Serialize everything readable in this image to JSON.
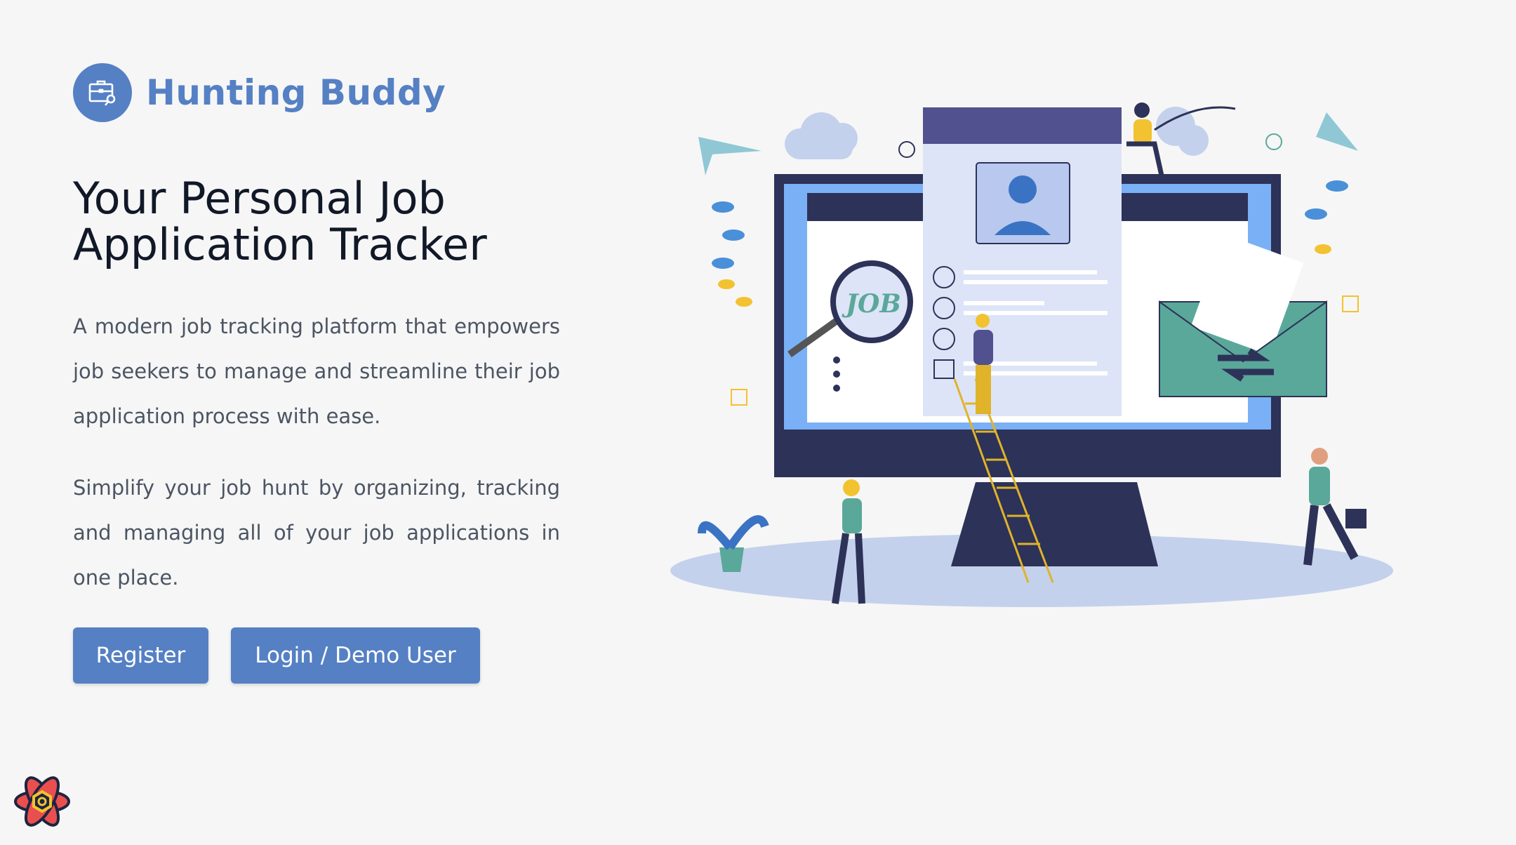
{
  "brand": {
    "name": "Hunting Buddy",
    "icon": "briefcase-search-icon",
    "color": "#5580c4"
  },
  "hero": {
    "title": "Your Personal Job Application Tracker",
    "paragraph_1": "A modern job tracking platform that empowers job seekers to manage and streamline their job application process with ease.",
    "paragraph_2": "Simplify your job hunt by organizing, tracking and managing all of your job applications in one place."
  },
  "buttons": {
    "register": "Register",
    "login": "Login / Demo User"
  },
  "illustration": {
    "magnifier_text": "JOB",
    "icon": "job-tracker-illustration"
  },
  "dev_tools": {
    "icon": "react-devtools-icon"
  }
}
